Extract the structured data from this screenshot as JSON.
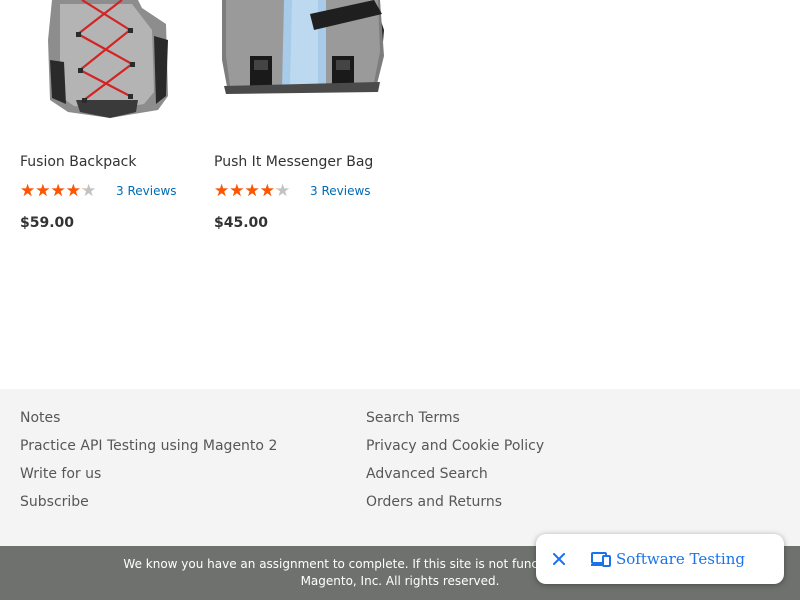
{
  "products": [
    {
      "name": "Fusion Backpack",
      "rating_fraction": 0.7,
      "reviews_label": "3 Reviews",
      "price": "$59.00"
    },
    {
      "name": "Push It Messenger Bag",
      "rating_fraction": 0.7,
      "reviews_label": "3 Reviews",
      "price": "$45.00"
    }
  ],
  "footer": {
    "col1": [
      "Notes",
      "Practice API Testing using Magento 2",
      "Write for us",
      "Subscribe"
    ],
    "col2": [
      "Search Terms",
      "Privacy and Cookie Policy",
      "Advanced Search",
      "Orders and Returns"
    ]
  },
  "copyright": {
    "line1": "We know you have an assignment to complete. If this site is not functioning as expected, dr",
    "line2": "Magento, Inc. All rights reserved."
  },
  "widget": {
    "label": "Software Testing",
    "close_icon": "close-icon",
    "app_icon": "devices-icon"
  },
  "colors": {
    "star_filled": "#ff5501",
    "star_empty": "#c2c2c2",
    "link": "#006bb4",
    "footer_bg": "#f4f4f4",
    "copyright_bg": "#6e716e",
    "widget_accent": "#1a73e8"
  }
}
